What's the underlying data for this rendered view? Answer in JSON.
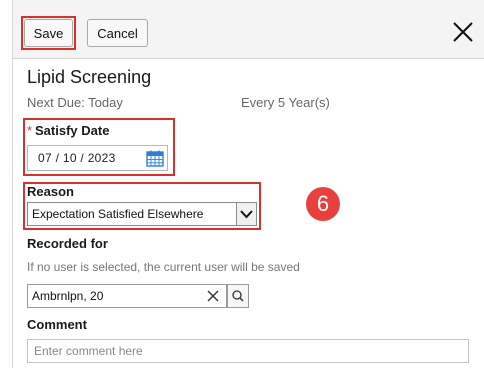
{
  "toolbar": {
    "save_label": "Save",
    "cancel_label": "Cancel",
    "close_icon": "close-icon"
  },
  "screening": {
    "title": "Lipid Screening",
    "next_due": "Next Due: Today",
    "frequency": "Every 5 Year(s)"
  },
  "satisfy_date": {
    "required_marker": "*",
    "label": "Satisfy Date",
    "value": "07 / 10 / 2023",
    "icon": "calendar-icon"
  },
  "reason": {
    "label": "Reason",
    "selected": "Expectation Satisfied Elsewhere"
  },
  "step_badge": "6",
  "recorded_for": {
    "label": "Recorded for",
    "helper": "If no user is selected, the current user will be saved",
    "value": "Ambrnlpn, 20",
    "clear_icon": "close-icon",
    "search_icon": "search-icon"
  },
  "comment": {
    "label": "Comment",
    "placeholder": "Enter comment here"
  },
  "colors": {
    "highlight": "#d9302c",
    "badge": "#e8403c",
    "calendar": "#2f7fd6"
  }
}
